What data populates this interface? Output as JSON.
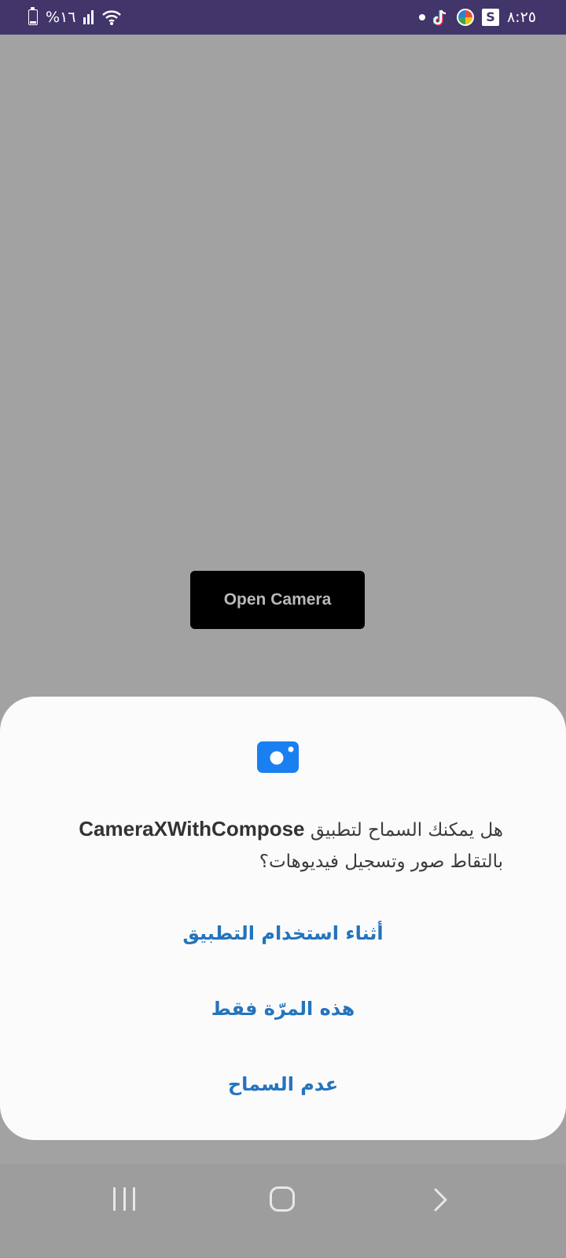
{
  "status_bar": {
    "time": "٨:٢٥",
    "battery_text": "%١٦",
    "icons": [
      "dot-icon",
      "tiktok-icon",
      "app-circle-icon",
      "s-icon",
      "battery-icon",
      "signal-icon",
      "wifi-icon"
    ],
    "s_label": "S",
    "background_color": "#42356a"
  },
  "main": {
    "open_camera_label": "Open Camera",
    "background_color": "#a3a2a3"
  },
  "permission_dialog": {
    "icon": "camera-icon",
    "message_prefix": "هل يمكنك السماح لتطبيق",
    "app_name": "CameraXWithCompose",
    "message_suffix": "بالتقاط صور وتسجيل فيديوهات؟",
    "options": {
      "while_using": "أثناء استخدام التطبيق",
      "only_this_time": "هذه المرّة فقط",
      "deny": "عدم السماح"
    },
    "accent_color": "#2474be",
    "icon_color": "#1a7ff0"
  },
  "nav_bar": {
    "icons": [
      "recents-icon",
      "home-icon",
      "back-icon"
    ]
  }
}
